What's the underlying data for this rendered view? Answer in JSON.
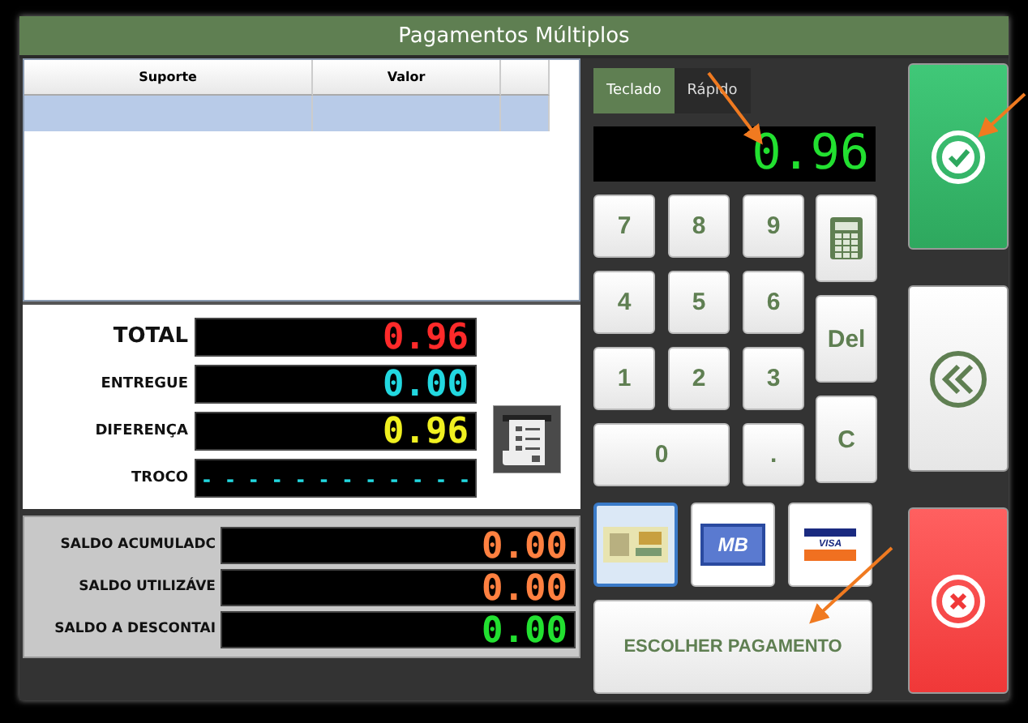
{
  "window": {
    "title": "Pagamentos Múltiplos"
  },
  "table": {
    "columns": [
      "Suporte",
      "Valor"
    ],
    "rows": [
      {
        "selected": true
      }
    ]
  },
  "totals": [
    {
      "kind": "total",
      "label": "TOTAL",
      "value": "0.96"
    },
    {
      "kind": "delivered",
      "label": "ENTREGUE",
      "value": "0.00"
    },
    {
      "kind": "difference",
      "label": "DIFERENÇA",
      "value": "0.96"
    },
    {
      "kind": "change",
      "label": "TROCO",
      "value": "- - - - - - - - - - - -"
    }
  ],
  "balances": [
    {
      "kind": "available",
      "label": "SALDO ACUMULADC",
      "value": "0.00"
    },
    {
      "kind": "available",
      "label": "SALDO UTILIZÁVE",
      "value": "0.00"
    },
    {
      "kind": "discount",
      "label": "SALDO A DESCONTAI",
      "value": "0.00"
    }
  ],
  "tabs": [
    {
      "label": "Teclado",
      "selected": true
    },
    {
      "label": "Rápido",
      "selected": false
    }
  ],
  "display": {
    "value": "0.96"
  },
  "keypad": {
    "digits": [
      "7",
      "8",
      "9",
      "4",
      "5",
      "6",
      "1",
      "2",
      "3",
      "0",
      "."
    ],
    "side": [
      {
        "kind": "calculator"
      },
      {
        "kind": "text",
        "label": "Del"
      },
      {
        "kind": "text",
        "label": "C"
      }
    ]
  },
  "payment_methods": [
    {
      "kind": "cash",
      "selected": true
    },
    {
      "kind": "mb",
      "logo": "MB",
      "selected": false
    },
    {
      "kind": "visa",
      "logo": "VISA",
      "selected": false
    }
  ],
  "choose_button": {
    "label": "ESCOLHER PAGAMENTO"
  },
  "actions": [
    {
      "kind": "confirm"
    },
    {
      "kind": "back"
    },
    {
      "kind": "cancel"
    }
  ]
}
